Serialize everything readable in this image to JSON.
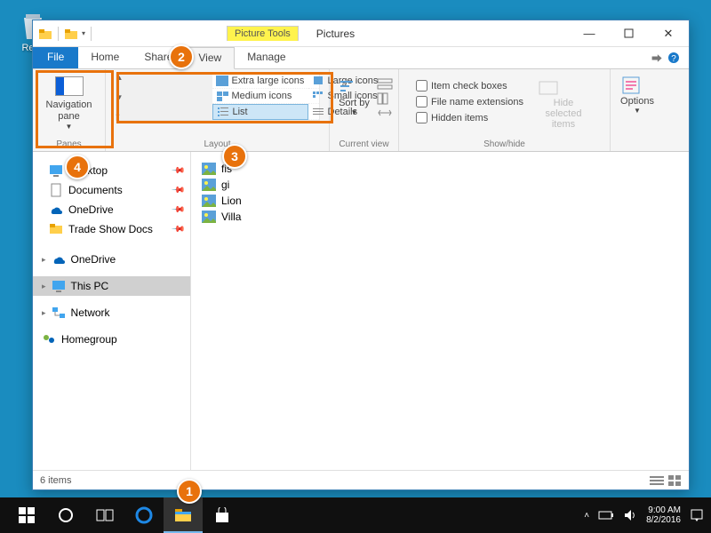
{
  "desktop": {
    "recycle_bin": "Recy"
  },
  "window": {
    "title": "Pictures",
    "picture_tools": "Picture Tools",
    "tabs": {
      "file": "File",
      "home": "Home",
      "share": "Share",
      "view": "View",
      "manage": "Manage"
    },
    "ribbon": {
      "panes_label": "Panes",
      "nav_pane": "Navigation pane",
      "layout_label": "Layout",
      "layout": {
        "xl": "Extra large icons",
        "lg": "Large icons",
        "md": "Medium icons",
        "sm": "Small icons",
        "list": "List",
        "details": "Details"
      },
      "current_view_label": "Current view",
      "sort_by": "Sort by",
      "showhide_label": "Show/hide",
      "checks": {
        "boxes": "Item check boxes",
        "ext": "File name extensions",
        "hidden": "Hidden items"
      },
      "hide_selected": "Hide selected items",
      "options": "Options"
    }
  },
  "sidebar": {
    "quick": [
      {
        "label": "Desktop"
      },
      {
        "label": "Documents"
      },
      {
        "label": "OneDrive"
      },
      {
        "label": "Trade Show Docs"
      }
    ],
    "onedrive": "OneDrive",
    "thispc": "This PC",
    "network": "Network",
    "homegroup": "Homegroup"
  },
  "files": [
    {
      "name": "fis"
    },
    {
      "name": "gi"
    },
    {
      "name": "Lion"
    },
    {
      "name": "Villa"
    }
  ],
  "status": {
    "count": "6 items"
  },
  "tray": {
    "time": "9:00 AM",
    "date": "8/2/2016"
  },
  "callouts": {
    "c1": "1",
    "c2": "2",
    "c3": "3",
    "c4": "4"
  }
}
